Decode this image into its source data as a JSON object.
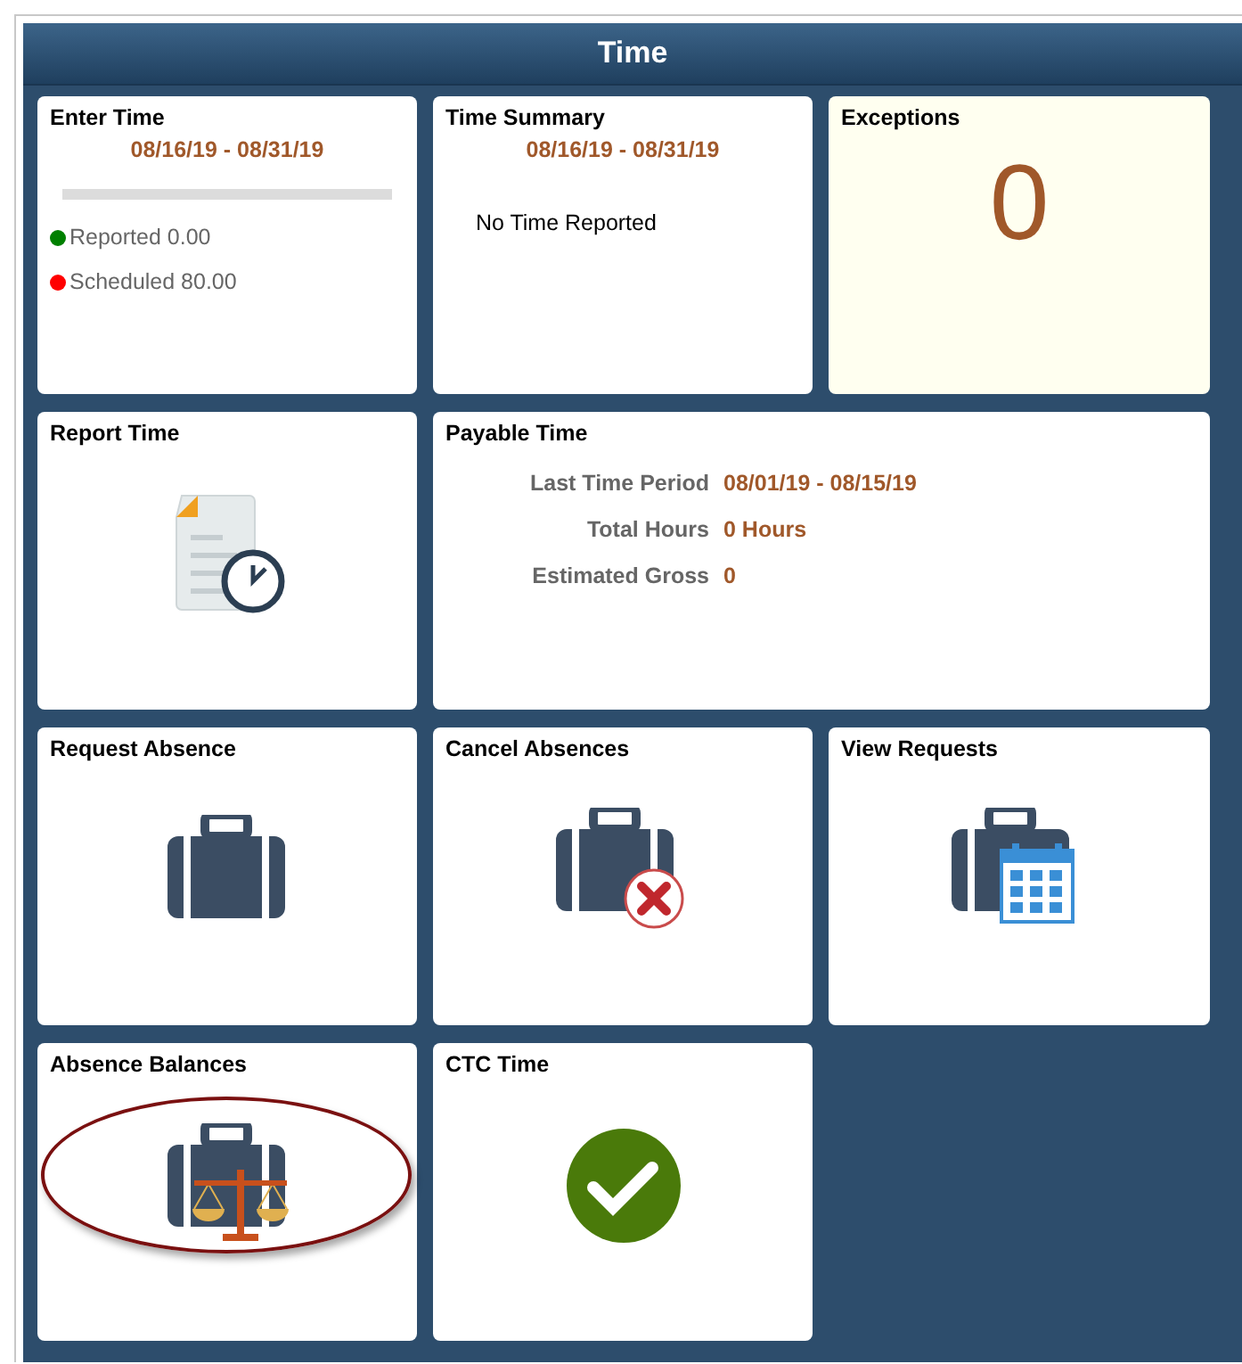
{
  "header": {
    "title": "Time"
  },
  "tiles": [
    {
      "kind": "entry",
      "title": "Enter Time",
      "period": "08/16/19 - 08/31/19",
      "highlighted": false,
      "legend": [
        {
          "label": "Reported 0.00",
          "color": "#008000"
        },
        {
          "label": "Scheduled 80.00",
          "color": "#ff0000"
        }
      ]
    },
    {
      "kind": "summary",
      "title": "Time Summary",
      "period": "08/16/19 - 08/31/19",
      "message": "No Time Reported",
      "highlighted": false
    },
    {
      "kind": "count",
      "title": "Exceptions",
      "count": "0",
      "highlighted": false
    },
    {
      "kind": "icon",
      "title": "Report Time",
      "highlighted": false
    },
    {
      "kind": "payable",
      "title": "Payable Time",
      "highlighted": false,
      "rows": [
        {
          "label": "Last Time Period",
          "value": "08/01/19 - 08/15/19"
        },
        {
          "label": "Total Hours",
          "value": "0 Hours"
        },
        {
          "label": "Estimated Gross",
          "value": "0"
        }
      ]
    },
    {
      "kind": "icon",
      "title": "Request Absence",
      "highlighted": false
    },
    {
      "kind": "icon",
      "title": "Cancel Absences",
      "highlighted": false
    },
    {
      "kind": "icon",
      "title": "View Requests",
      "highlighted": false
    },
    {
      "kind": "icon",
      "title": "Absence Balances",
      "highlighted": true
    },
    {
      "kind": "icon",
      "title": "CTC Time",
      "highlighted": false
    }
  ]
}
